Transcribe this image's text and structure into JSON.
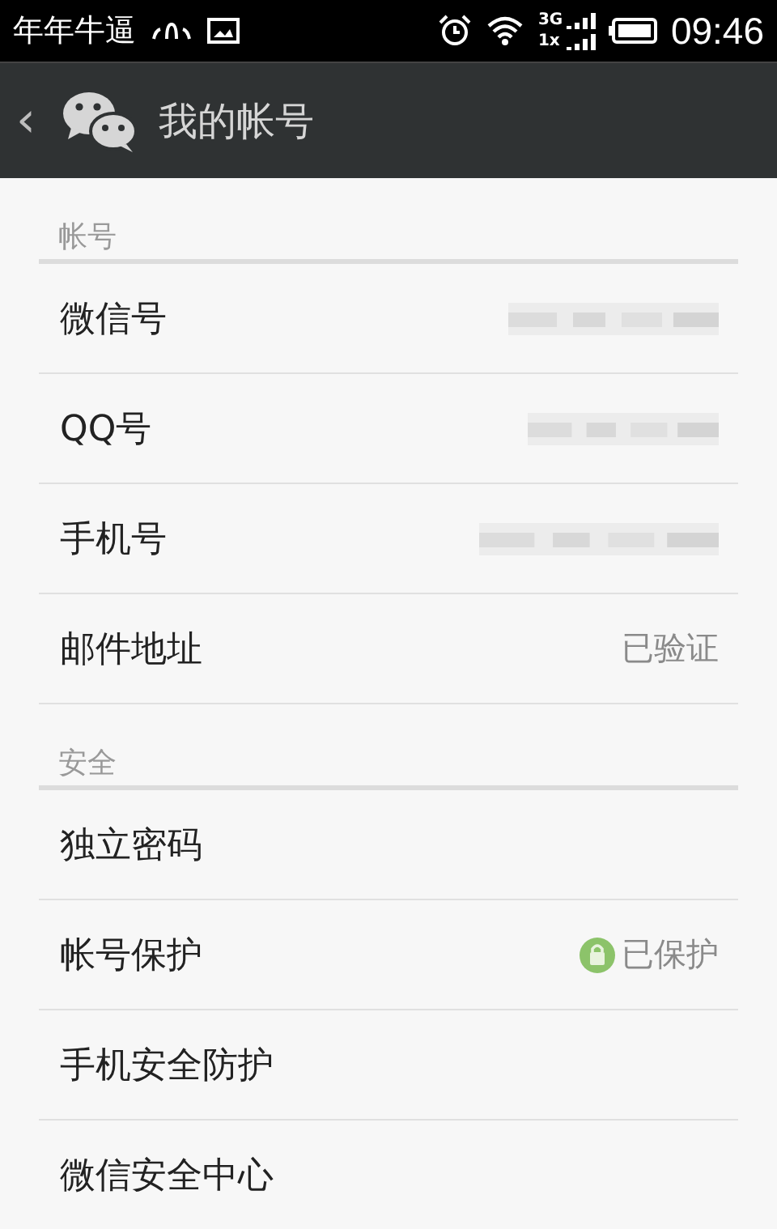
{
  "status_bar": {
    "carrier": "年年牛逼",
    "network_top": "3G",
    "network_bottom": "1x",
    "time": "09:46"
  },
  "header": {
    "back": "‹",
    "title": "我的帐号"
  },
  "sections": [
    {
      "title": "帐号",
      "rows": [
        {
          "label": "微信号",
          "kind": "blurred"
        },
        {
          "label": "QQ号",
          "kind": "blurred"
        },
        {
          "label": "手机号",
          "kind": "blurred"
        },
        {
          "label": "邮件地址",
          "kind": "text",
          "value": "已验证"
        }
      ]
    },
    {
      "title": "安全",
      "rows": [
        {
          "label": "独立密码",
          "kind": "empty"
        },
        {
          "label": "帐号保护",
          "kind": "locked",
          "value": "已保护"
        },
        {
          "label": "手机安全防护",
          "kind": "empty"
        },
        {
          "label": "微信安全中心",
          "kind": "empty"
        }
      ]
    }
  ]
}
